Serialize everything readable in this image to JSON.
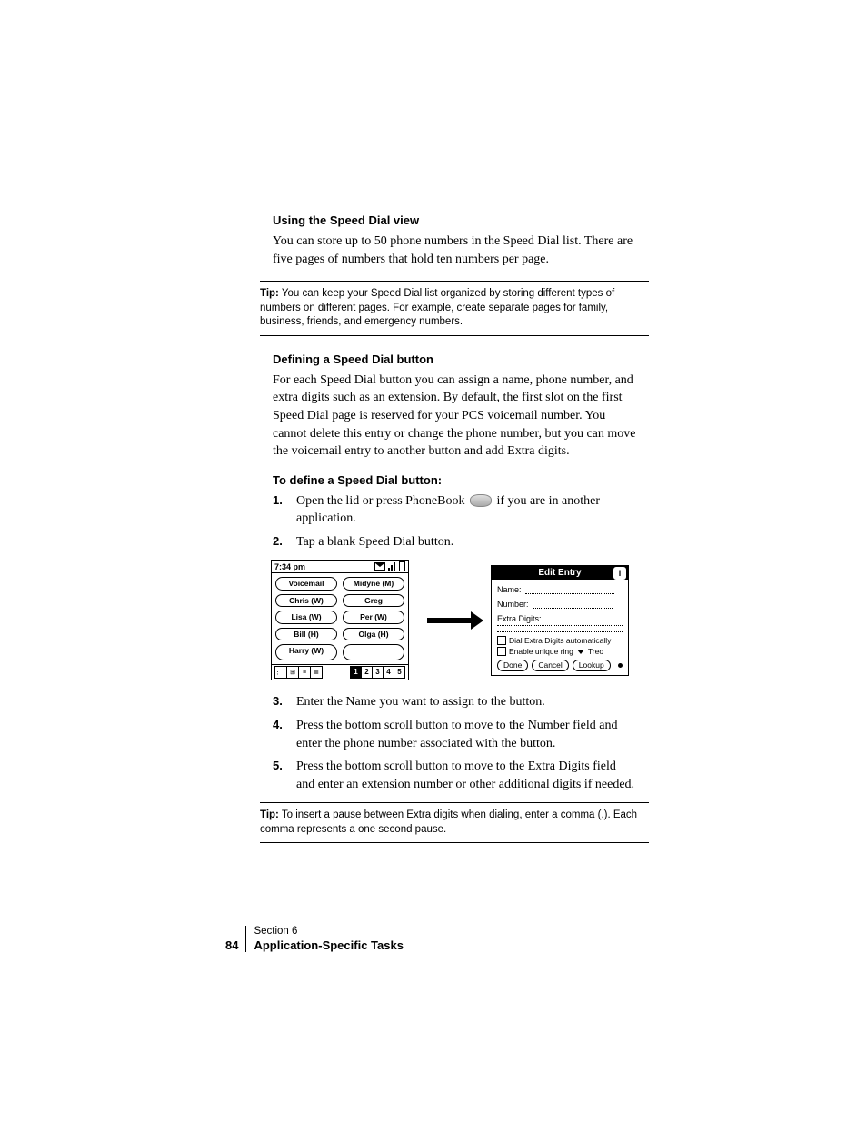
{
  "section1": {
    "heading": "Using the Speed Dial view",
    "body": "You can store up to 50 phone numbers in the Speed Dial list. There are five pages of numbers that hold ten numbers per page."
  },
  "tip1": {
    "label": "Tip:",
    "body": " You can keep your Speed Dial list organized by storing different types of numbers on different pages. For example, create separate pages for family, business, friends, and emergency numbers."
  },
  "section2": {
    "heading": "Defining a Speed Dial button",
    "body": "For each Speed Dial button you can assign a name, phone number, and extra digits such as an extension. By default, the first slot on the first Speed Dial page is reserved for your PCS voicemail number. You cannot delete this entry or change the phone number, but you can move the voicemail entry to another button and add Extra digits."
  },
  "steps_heading": "To define a Speed Dial button:",
  "steps_a": [
    {
      "n": "1.",
      "t_before": "Open the lid or press PhoneBook ",
      "t_after": " if you are in another application."
    },
    {
      "n": "2.",
      "t_before": "Tap a blank Speed Dial button.",
      "t_after": ""
    }
  ],
  "device": {
    "time": "7:34 pm",
    "buttons": [
      [
        "Voicemail",
        "Midyne (M)"
      ],
      [
        "Chris (W)",
        "Greg"
      ],
      [
        "Lisa (W)",
        "Per (W)"
      ],
      [
        "Bill (H)",
        "Olga (H)"
      ],
      [
        "Harry (W)",
        ""
      ]
    ],
    "pages": [
      "1",
      "2",
      "3",
      "4",
      "5"
    ],
    "active_page": 0
  },
  "dialog": {
    "title": "Edit Entry",
    "name_label": "Name:",
    "number_label": "Number:",
    "extra_label": "Extra Digits:",
    "chk1": "Dial Extra Digits automatically",
    "chk2_prefix": "Enable unique ring",
    "chk2_suffix": "Treo",
    "btn_done": "Done",
    "btn_cancel": "Cancel",
    "btn_lookup": "Lookup"
  },
  "steps_b": [
    {
      "n": "3.",
      "t": "Enter the Name you want to assign to the button."
    },
    {
      "n": "4.",
      "t": "Press the bottom scroll button to move to the Number field and enter the phone number associated with the button."
    },
    {
      "n": "5.",
      "t": "Press the bottom scroll button to move to the Extra Digits field and enter an extension number or other additional digits if needed."
    }
  ],
  "tip2": {
    "label": "Tip:",
    "body": " To insert a pause between Extra digits when dialing, enter a comma (,). Each comma represents a one second pause."
  },
  "footer": {
    "page_number": "84",
    "section": "Section 6",
    "title": "Application-Specific Tasks"
  }
}
